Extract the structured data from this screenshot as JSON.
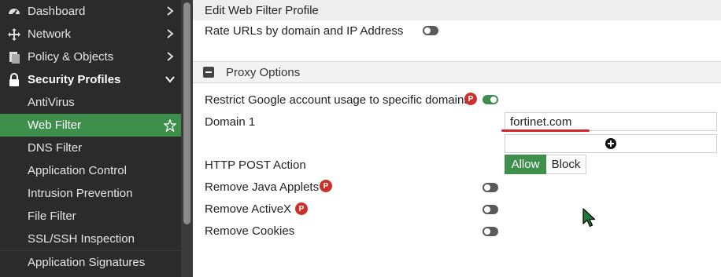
{
  "sidebar": {
    "items": [
      {
        "label": "Dashboard",
        "icon": "dashboard-icon",
        "chevron": "right"
      },
      {
        "label": "Network",
        "icon": "network-icon",
        "chevron": "right"
      },
      {
        "label": "Policy & Objects",
        "icon": "policy-icon",
        "chevron": "right"
      },
      {
        "label": "Security Profiles",
        "icon": "lock-icon",
        "chevron": "down"
      },
      {
        "label": "AntiVirus"
      },
      {
        "label": "Web Filter",
        "icon": "star-icon"
      },
      {
        "label": "DNS Filter"
      },
      {
        "label": "Application Control"
      },
      {
        "label": "Intrusion Prevention"
      },
      {
        "label": "File Filter"
      },
      {
        "label": "SSL/SSH Inspection"
      },
      {
        "label": "Application Signatures"
      }
    ],
    "active_item": "Web Filter"
  },
  "main": {
    "title": "Edit Web Filter Profile",
    "rate_urls": {
      "label": "Rate URLs by domain and IP Address",
      "enabled": false
    },
    "proxy_section": {
      "label": "Proxy Options",
      "expanded": true
    },
    "restrict_google": {
      "label": "Restrict Google account usage to specific domains",
      "badge": "P",
      "enabled": true
    },
    "domain": {
      "label": "Domain 1",
      "value": "fortinet.com"
    },
    "http_post": {
      "label": "HTTP POST Action",
      "options": [
        "Allow",
        "Block"
      ],
      "selected": "Allow"
    },
    "remove_java": {
      "label": "Remove Java Applets",
      "badge": "P",
      "enabled": false
    },
    "remove_activex": {
      "label": "Remove ActiveX",
      "badge": "P",
      "enabled": false
    },
    "remove_cookies": {
      "label": "Remove Cookies",
      "enabled": false
    }
  },
  "colors": {
    "sidebar_bg": "#2b2b2b",
    "accent_green": "#3e8e4c",
    "badge_red": "#c8322b",
    "underline_red": "#d0282e"
  }
}
